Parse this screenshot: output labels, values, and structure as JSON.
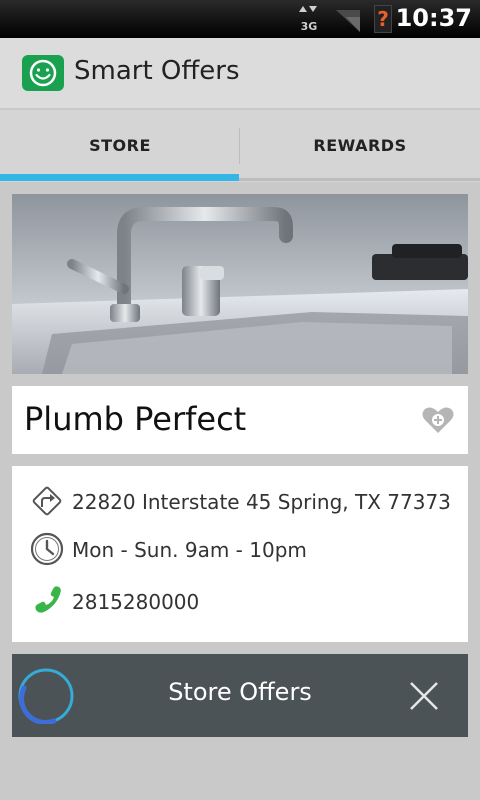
{
  "status_bar": {
    "network": "3G",
    "battery_glyph": "?",
    "time": "10:37"
  },
  "app": {
    "title": "Smart Offers",
    "logo_icon": "smiley-face-icon",
    "brand_color": "#1aa14f"
  },
  "tabs": [
    {
      "label": "STORE",
      "selected": true
    },
    {
      "label": "REWARDS",
      "selected": false
    }
  ],
  "accent_color": "#33b5e5",
  "store": {
    "name": "Plumb Perfect",
    "favorite_icon": "heart-plus-icon",
    "address": "22820 Interstate 45 Spring, TX 77373",
    "hours": "Mon - Sun. 9am - 10pm",
    "phone": "2815280000"
  },
  "offers_bar": {
    "label": "Store Offers",
    "loading": true,
    "close_icon": "close-icon"
  }
}
